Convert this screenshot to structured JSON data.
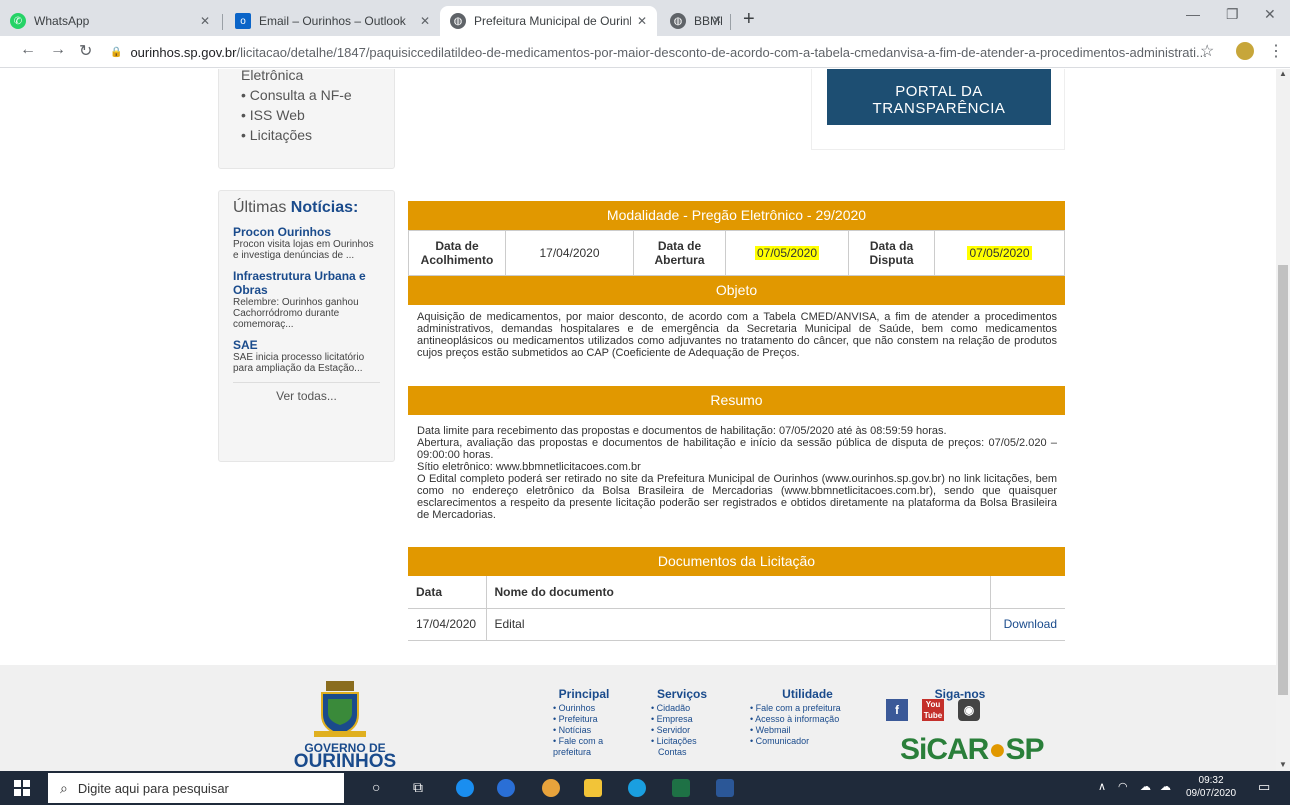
{
  "browser": {
    "tabs": [
      {
        "title": "WhatsApp",
        "icon": "whatsapp-icon",
        "active": false
      },
      {
        "title": "Email – Ourinhos – Outlook",
        "icon": "outlook-icon",
        "active": false
      },
      {
        "title": "Prefeitura Municipal de Ourinhos",
        "icon": "globe-icon",
        "active": true
      },
      {
        "title": "BBMNet",
        "icon": "globe-icon",
        "active": false
      }
    ],
    "url_host": "ourinhos.sp.gov.br",
    "url_path": "/licitacao/detalhe/1847/paquisiccedilatildeo-de-medicamentos-por-maior-desconto-de-acordo-com-a-tabela-cmedanvisa-a-fim-de-atender-a-procedimentos-administrati..."
  },
  "sidebar": {
    "quick_links": [
      "Nota Fiscal Eletrônica",
      "• Consulta a NF-e",
      "• ISS Web",
      "• Licitações"
    ],
    "quick_link_first": "Eletrônica",
    "news_heading_a": "Últimas ",
    "news_heading_b": "Notícias:",
    "news": [
      {
        "title": "Procon Ourinhos",
        "body": "Procon visita lojas em Ourinhos e investiga denúncias de ..."
      },
      {
        "title": "Infraestrutura Urbana e Obras",
        "body": "Relembre: Ourinhos ganhou Cachorródromo durante comemoraç..."
      },
      {
        "title": "SAE",
        "body": "SAE inicia processo licitatório para ampliação da Estação..."
      }
    ],
    "see_all": "Ver todas..."
  },
  "portal": {
    "line1": "PORTAL DA",
    "line2": "TRANSPARÊNCIA"
  },
  "licitacao": {
    "modalidade": "Modalidade - Pregão Eletrônico - 29/2020",
    "acolhimento_label": "Data de Acolhimento",
    "acolhimento_value": "17/04/2020",
    "abertura_label": "Data de Abertura",
    "abertura_value": "07/05/2020",
    "disputa_label": "Data da Disputa",
    "disputa_value": "07/05/2020",
    "objeto_title": "Objeto",
    "objeto_text": "Aquisição de medicamentos, por maior desconto, de acordo com a Tabela CMED/ANVISA, a fim de atender a procedimentos administrativos, demandas hospitalares e de emergência da Secretaria Municipal de Saúde, bem como medicamentos antineoplásicos ou medicamentos utilizados como adjuvantes no tratamento do câncer, que não constem na relação de produtos cujos preços estão submetidos ao CAP (Coeficiente de Adequação de Preços.",
    "resumo_title": "Resumo",
    "resumo_lines": [
      "Data limite para recebimento das propostas e documentos de habilitação: 07/05/2020 até às 08:59:59 horas.",
      "Abertura, avaliação das propostas e documentos de habilitação e início da sessão pública de disputa de preços: 07/05/2.020 – 09:00:00 horas.",
      "Sítio eletrônico: www.bbmnetlicitacoes.com.br",
      "O Edital completo poderá ser retirado no site da Prefeitura Municipal de Ourinhos (www.ourinhos.sp.gov.br) no link licitações, bem como no endereço eletrônico da Bolsa Brasileira de Mercadorias (www.bbmnetlicitacoes.com.br), sendo que quaisquer esclarecimentos a respeito da presente licitação poderão ser registrados e obtidos diretamente na plataforma da Bolsa Brasileira de Mercadorias."
    ],
    "docs_title": "Documentos da Licitação",
    "docs_headers": [
      "Data",
      "Nome do documento"
    ],
    "docs": [
      {
        "date": "17/04/2020",
        "name": "Edital",
        "action": "Download"
      }
    ]
  },
  "footer": {
    "gov_line1": "GOVERNO DE",
    "gov_line2": "OURINHOS",
    "principal": {
      "title": "Principal",
      "items": [
        "• Ourinhos",
        "• Prefeitura",
        "• Notícias",
        "• Fale com a prefeitura"
      ]
    },
    "servicos": {
      "title": "Serviços",
      "items": [
        "• Cidadão",
        "• Empresa",
        "• Servidor",
        "• Licitações",
        "Contas"
      ]
    },
    "utilidade": {
      "title": "Utilidade",
      "items": [
        "• Fale com a prefeitura",
        "• Acesso à informação",
        "• Webmail",
        "• Comunicador"
      ]
    },
    "siga": {
      "title": "Siga-nos"
    },
    "sicar_a": "SiCAR",
    "sicar_b": "SP"
  },
  "taskbar": {
    "search_placeholder": "Digite aqui para pesquisar",
    "time": "09:32",
    "date": "09/07/2020"
  },
  "colors": {
    "accent": "#e19800",
    "portal": "#1d4e72",
    "link": "#1a4b8c",
    "highlight": "#ffff00"
  }
}
